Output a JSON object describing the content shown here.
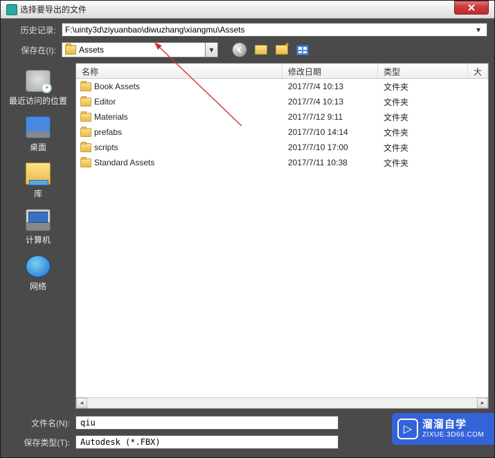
{
  "window": {
    "title": "选择要导出的文件"
  },
  "history": {
    "label": "历史记录:",
    "value": "F:\\uinty3d\\ziyuanbao\\diwuzhang\\xiangmu\\Assets"
  },
  "savein": {
    "label": "保存在(I):",
    "value": "Assets"
  },
  "columns": {
    "name": "名称",
    "date": "修改日期",
    "type": "类型",
    "size": "大"
  },
  "files": [
    {
      "name": "Book Assets",
      "date": "2017/7/4 10:13",
      "type": "文件夹"
    },
    {
      "name": "Editor",
      "date": "2017/7/4 10:13",
      "type": "文件夹"
    },
    {
      "name": "Materials",
      "date": "2017/7/12 9:11",
      "type": "文件夹"
    },
    {
      "name": "prefabs",
      "date": "2017/7/10 14:14",
      "type": "文件夹"
    },
    {
      "name": "scripts",
      "date": "2017/7/10 17:00",
      "type": "文件夹"
    },
    {
      "name": "Standard Assets",
      "date": "2017/7/11 10:38",
      "type": "文件夹"
    }
  ],
  "places": {
    "recent": "最近访问的位置",
    "desktop": "桌面",
    "library": "库",
    "computer": "计算机",
    "network": "网络"
  },
  "filename": {
    "label": "文件名(N):",
    "value": "qiu"
  },
  "filetype": {
    "label": "保存类型(T):",
    "value": "Autodesk (*.FBX)"
  },
  "watermark": {
    "big": "溜溜自学",
    "small": "ZIXUE.3D66.COM"
  }
}
